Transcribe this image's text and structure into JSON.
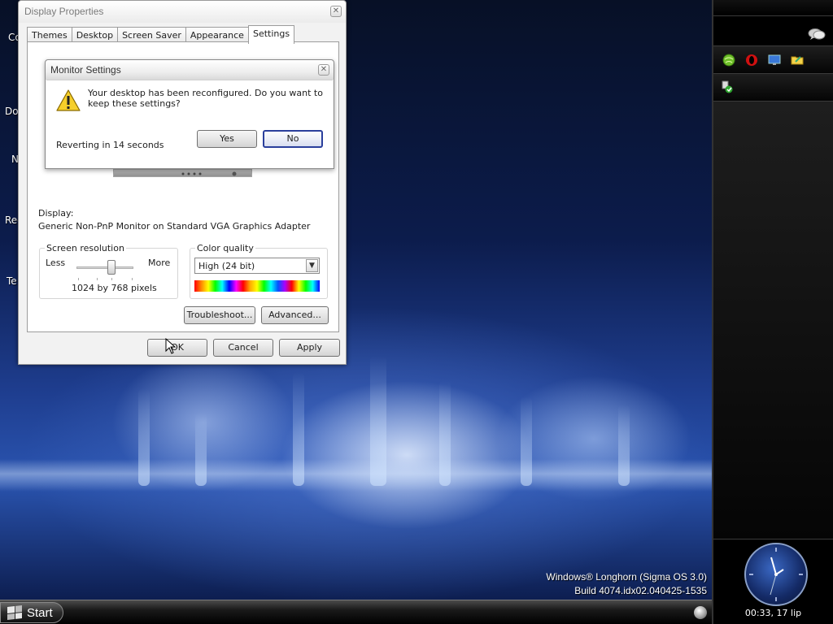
{
  "desktop": {
    "icon_labels": [
      "Co",
      "Do",
      "N",
      "Rec",
      "Te"
    ],
    "brand_line1": "Windows® Longhorn (Sigma OS 3.0)",
    "brand_line2": "Build 4074.idx02.040425-1535"
  },
  "taskbar": {
    "start_label": "Start"
  },
  "sidebar": {
    "clock_text": "00:33, 17 lip",
    "quick_icons": [
      "green-globe-icon",
      "opera-icon",
      "monitor-icon",
      "folder-icon"
    ],
    "tray_icon": "security-shield-icon"
  },
  "display_properties": {
    "title": "Display Properties",
    "tabs": [
      {
        "label": "Themes",
        "active": false
      },
      {
        "label": "Desktop",
        "active": false
      },
      {
        "label": "Screen Saver",
        "active": false
      },
      {
        "label": "Appearance",
        "active": false
      },
      {
        "label": "Settings",
        "active": true
      }
    ],
    "display_label": "Display:",
    "display_value": "Generic Non-PnP Monitor on Standard VGA Graphics Adapter",
    "screen_resolution": {
      "title": "Screen resolution",
      "less": "Less",
      "more": "More",
      "value_text": "1024 by 768 pixels"
    },
    "color_quality": {
      "title": "Color quality",
      "selected": "High (24 bit)"
    },
    "buttons": {
      "troubleshoot": "Troubleshoot...",
      "advanced": "Advanced...",
      "ok": "OK",
      "cancel": "Cancel",
      "apply": "Apply"
    }
  },
  "monitor_settings": {
    "title": "Monitor Settings",
    "message": "Your desktop has been reconfigured.  Do you want to keep these settings?",
    "revert_text": "Reverting in 14 seconds",
    "yes_label": "Yes",
    "no_label": "No"
  },
  "colors": {
    "accent": "#2a3f9c",
    "window_bg": "#f2f2f2",
    "sidebar_bg": "#000000"
  }
}
